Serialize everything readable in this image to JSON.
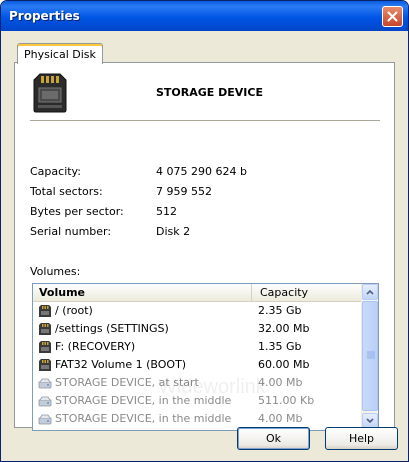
{
  "window": {
    "title": "Properties",
    "close_icon": "close-icon"
  },
  "tabs": [
    {
      "label": "Physical Disk",
      "selected": true
    }
  ],
  "device": {
    "icon": "storage-device-icon",
    "name": "STORAGE DEVICE"
  },
  "properties": [
    {
      "label": "Capacity:",
      "value": "4 075 290 624  b"
    },
    {
      "label": "Total sectors:",
      "value": "7 959 552"
    },
    {
      "label": "Bytes per sector:",
      "value": "512"
    },
    {
      "label": "Serial number:",
      "value": "Disk 2"
    }
  ],
  "volumes": {
    "label": "Volumes:",
    "columns": [
      "Volume",
      "Capacity"
    ],
    "rows": [
      {
        "name": "/ (root)",
        "capacity": "2.35 Gb",
        "icon": "volume-icon",
        "unallocated": false
      },
      {
        "name": "/settings (SETTINGS)",
        "capacity": "32.00 Mb",
        "icon": "volume-icon",
        "unallocated": false
      },
      {
        "name": "F: (RECOVERY)",
        "capacity": "1.35 Gb",
        "icon": "volume-icon",
        "unallocated": false
      },
      {
        "name": "FAT32 Volume 1 (BOOT)",
        "capacity": "60.00 Mb",
        "icon": "volume-icon",
        "unallocated": false
      },
      {
        "name": "STORAGE DEVICE, at start",
        "capacity": "4.00 Mb",
        "icon": "free-space-icon",
        "unallocated": true
      },
      {
        "name": "STORAGE DEVICE, in the middle",
        "capacity": "511.00 Kb",
        "icon": "free-space-icon",
        "unallocated": true
      },
      {
        "name": "STORAGE DEVICE, in the middle",
        "capacity": "4.00 Mb",
        "icon": "free-space-icon",
        "unallocated": true
      }
    ]
  },
  "watermark": "Wideworlink",
  "buttons": {
    "ok": "Ok",
    "help": "Help"
  },
  "colors": {
    "titlebar": "#0055E5",
    "dialog_bg": "#ECE9D8",
    "panel_bg": "#FFFFFF",
    "tab_accent": "#FFC83C",
    "scrollbar": "#C2D4F6"
  }
}
